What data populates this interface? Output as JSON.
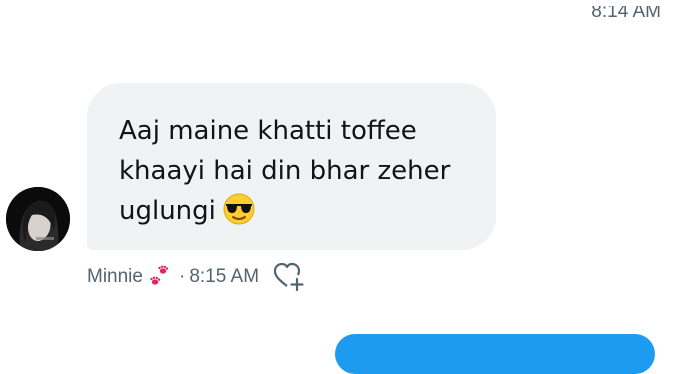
{
  "previous_message": {
    "timestamp": "8:14 AM"
  },
  "message": {
    "lines": [
      "Aaj maine khatti toffee",
      "khaayi hai din bhar zeher",
      "uglungi"
    ],
    "emoji": "smiling-face-with-sunglasses",
    "sender_name": "Minnie",
    "sender_badge": "paw-prints-icon",
    "separator": "·",
    "time": "8:15 AM"
  },
  "colors": {
    "incoming_bubble": "#eff3f4",
    "outgoing_bubble": "#1d9bf0",
    "meta_text": "#536471",
    "text": "#0f1419",
    "paw": "#e0245e"
  }
}
